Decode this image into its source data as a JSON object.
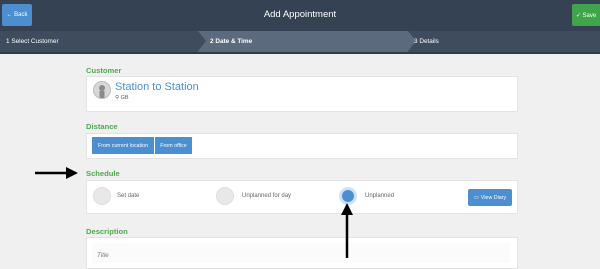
{
  "header": {
    "back_label": "← Back",
    "title": "Add Appointment",
    "save_label": "✓ Save"
  },
  "steps": [
    {
      "label": "1 Select Customer"
    },
    {
      "label": "2 Date & Time"
    },
    {
      "label": "3 Details"
    }
  ],
  "customer": {
    "section_label": "Customer",
    "name": "Station to Station",
    "location": "GB"
  },
  "distance": {
    "section_label": "Distance",
    "from_current_label": "From current location",
    "from_office_label": "From office"
  },
  "schedule": {
    "section_label": "Schedule",
    "options": [
      {
        "label": "Set date",
        "selected": false
      },
      {
        "label": "Unplanned for day",
        "selected": false
      },
      {
        "label": "Unplanned",
        "selected": true
      }
    ],
    "view_diary_label": "View Diary"
  },
  "description": {
    "section_label": "Description",
    "title_placeholder": "Title"
  },
  "colors": {
    "topbar": "#344253",
    "accent_blue": "#4b8fd1",
    "accent_green": "#4ea84e",
    "save_green": "#3fa44a"
  }
}
